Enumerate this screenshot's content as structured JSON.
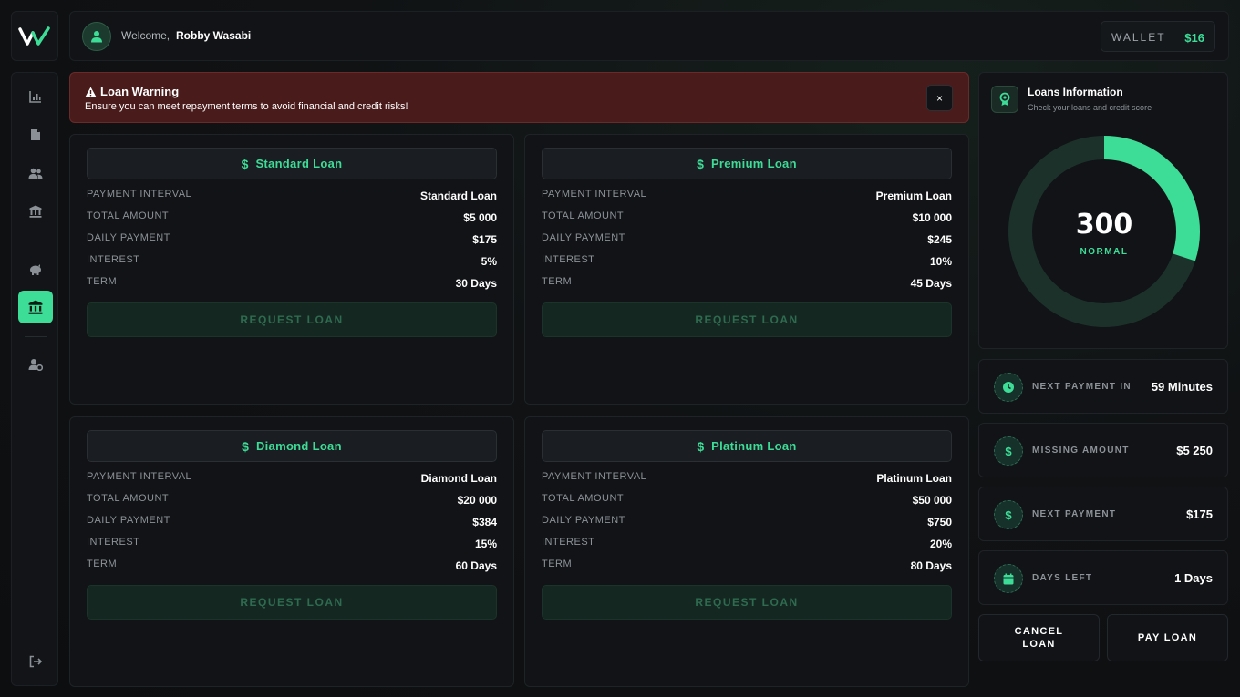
{
  "header": {
    "welcome_label": "Welcome,",
    "username": "Robby Wasabi",
    "wallet_label": "WALLET",
    "wallet_value": "$16"
  },
  "sidebar": {
    "items": [
      {
        "name": "chart-icon",
        "active": false
      },
      {
        "name": "document-icon",
        "active": false
      },
      {
        "name": "users-icon",
        "active": false
      },
      {
        "name": "bank-icon",
        "active": false
      },
      {
        "name": "piggy-bank-icon",
        "active": false
      },
      {
        "name": "bank-icon",
        "active": true
      },
      {
        "name": "user-settings-icon",
        "active": false
      }
    ],
    "logout_icon": "logout-icon"
  },
  "warning": {
    "title": "Loan Warning",
    "text": "Ensure you can meet repayment terms to avoid financial and credit risks!",
    "close": "×"
  },
  "labels": {
    "payment_interval": "PAYMENT INTERVAL",
    "total_amount": "TOTAL AMOUNT",
    "daily_payment": "DAILY PAYMENT",
    "interest": "INTEREST",
    "term": "TERM",
    "request": "REQUEST LOAN"
  },
  "loans": [
    {
      "title": "Standard Loan",
      "payment_interval": "Standard Loan",
      "total_amount": "$5 000",
      "daily_payment": "$175",
      "interest": "5%",
      "term": "30 Days"
    },
    {
      "title": "Premium Loan",
      "payment_interval": "Premium Loan",
      "total_amount": "$10 000",
      "daily_payment": "$245",
      "interest": "10%",
      "term": "45 Days"
    },
    {
      "title": "Diamond Loan",
      "payment_interval": "Diamond Loan",
      "total_amount": "$20 000",
      "daily_payment": "$384",
      "interest": "15%",
      "term": "60 Days"
    },
    {
      "title": "Platinum Loan",
      "payment_interval": "Platinum Loan",
      "total_amount": "$50 000",
      "daily_payment": "$750",
      "interest": "20%",
      "term": "80 Days"
    }
  ],
  "info": {
    "title": "Loans Information",
    "subtitle": "Check your loans and credit score",
    "score": "300",
    "score_status": "NORMAL",
    "score_fraction": 0.3
  },
  "stats": [
    {
      "label": "NEXT PAYMENT IN",
      "value": "59 Minutes",
      "icon": "clock-icon"
    },
    {
      "label": "MISSING AMOUNT",
      "value": "$5 250",
      "icon": "dollar-icon"
    },
    {
      "label": "NEXT PAYMENT",
      "value": "$175",
      "icon": "dollar-icon"
    },
    {
      "label": "DAYS LEFT",
      "value": "1 Days",
      "icon": "calendar-icon"
    }
  ],
  "actions": {
    "cancel": "CANCEL LOAN",
    "pay": "PAY LOAN"
  },
  "colors": {
    "accent": "#3ddc97",
    "warning_bg": "#4a1b1b"
  }
}
